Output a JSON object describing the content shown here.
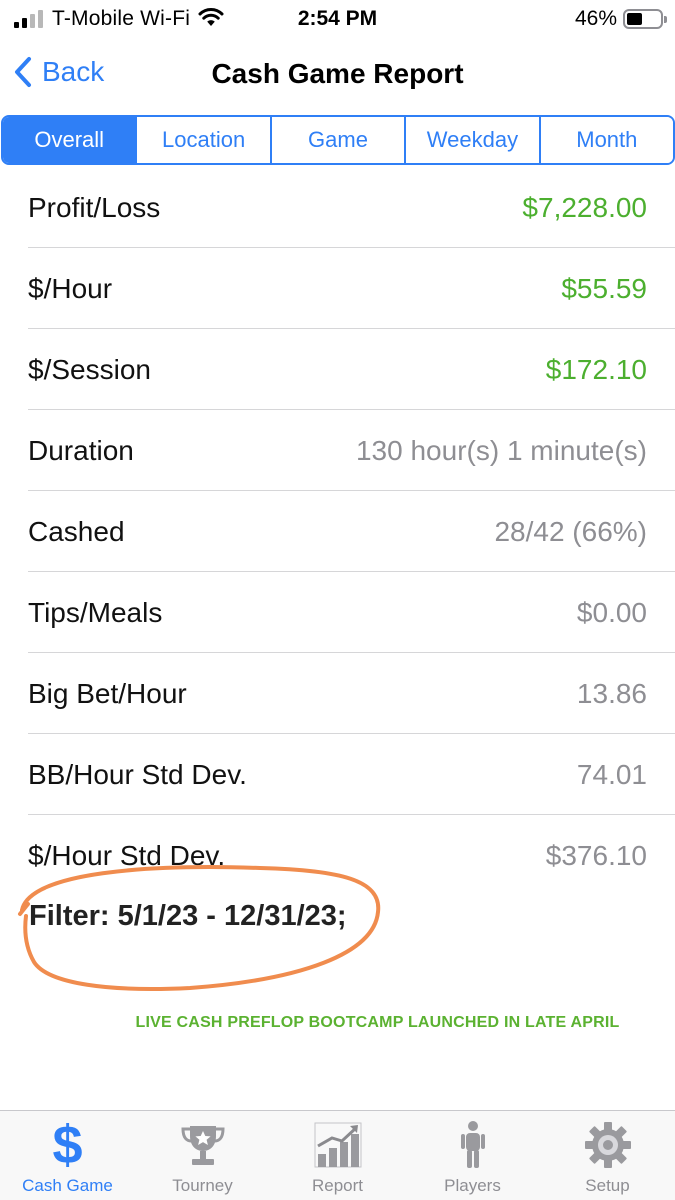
{
  "status_bar": {
    "carrier": "T-Mobile Wi-Fi",
    "time": "2:54 PM",
    "battery_percent": "46%",
    "battery_level": 0.46,
    "signal_bars_filled": 2,
    "signal_bars_total": 4
  },
  "nav": {
    "back_label": "Back",
    "title": "Cash Game Report"
  },
  "segments": {
    "items": [
      "Overall",
      "Location",
      "Game",
      "Weekday",
      "Month"
    ],
    "selected": "Overall"
  },
  "report": {
    "rows": [
      {
        "label": "Profit/Loss",
        "value": "$7,228.00",
        "positive": true
      },
      {
        "label": "$/Hour",
        "value": "$55.59",
        "positive": true
      },
      {
        "label": "$/Session",
        "value": "$172.10",
        "positive": true
      },
      {
        "label": "Duration",
        "value": "130 hour(s) 1 minute(s)",
        "positive": false
      },
      {
        "label": "Cashed",
        "value": "28/42 (66%)",
        "positive": false
      },
      {
        "label": "Tips/Meals",
        "value": "$0.00",
        "positive": false
      },
      {
        "label": "Big Bet/Hour",
        "value": "13.86",
        "positive": false
      },
      {
        "label": "BB/Hour Std Dev.",
        "value": "74.01",
        "positive": false
      },
      {
        "label": "$/Hour Std Dev.",
        "value": "$376.10",
        "positive": false
      }
    ],
    "filter": "Filter: 5/1/23 - 12/31/23;",
    "banner": "LIVE CASH PREFLOP BOOTCAMP LAUNCHED IN LATE APRIL"
  },
  "tab_bar": {
    "items": [
      {
        "label": "Cash Game",
        "icon": "dollar-icon"
      },
      {
        "label": "Tourney",
        "icon": "trophy-icon"
      },
      {
        "label": "Report",
        "icon": "chart-icon"
      },
      {
        "label": "Players",
        "icon": "person-icon"
      },
      {
        "label": "Setup",
        "icon": "gear-icon"
      }
    ],
    "selected": "Cash Game"
  },
  "colors": {
    "accent": "#2f7ff6",
    "positive": "#4caf2f",
    "muted": "#8e8e93",
    "annotation": "#f08c4e",
    "banner": "#5bb231"
  }
}
